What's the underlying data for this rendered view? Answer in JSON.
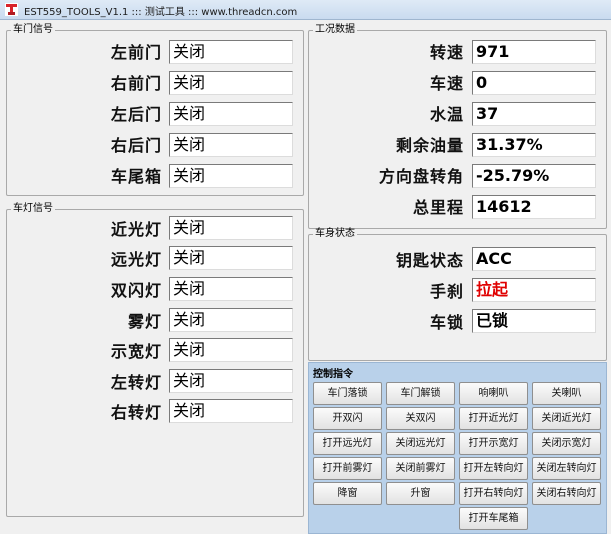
{
  "window": {
    "title": "EST559_TOOLS_V1.1 ::: 测试工具 ::: www.threadcn.com"
  },
  "door_group": {
    "title": "车门信号",
    "rows": [
      {
        "label": "左前门",
        "value": "关闭"
      },
      {
        "label": "右前门",
        "value": "关闭"
      },
      {
        "label": "左后门",
        "value": "关闭"
      },
      {
        "label": "右后门",
        "value": "关闭"
      },
      {
        "label": "车尾箱",
        "value": "关闭"
      }
    ]
  },
  "light_group": {
    "title": "车灯信号",
    "rows": [
      {
        "label": "近光灯",
        "value": "关闭"
      },
      {
        "label": "远光灯",
        "value": "关闭"
      },
      {
        "label": "双闪灯",
        "value": "关闭"
      },
      {
        "label": "雾灯",
        "value": "关闭"
      },
      {
        "label": "示宽灯",
        "value": "关闭"
      },
      {
        "label": "左转灯",
        "value": "关闭"
      },
      {
        "label": "右转灯",
        "value": "关闭"
      }
    ]
  },
  "work_group": {
    "title": "工况数据",
    "rows": [
      {
        "label": "转速",
        "value": "971"
      },
      {
        "label": "车速",
        "value": "0"
      },
      {
        "label": "水温",
        "value": "37"
      },
      {
        "label": "剩余油量",
        "value": "31.37%"
      },
      {
        "label": "方向盘转角",
        "value": "-25.79%"
      },
      {
        "label": "总里程",
        "value": "14612"
      }
    ]
  },
  "body_group": {
    "title": "车身状态",
    "rows": [
      {
        "label": "钥匙状态",
        "value": "ACC"
      },
      {
        "label": "手刹",
        "value": "拉起"
      },
      {
        "label": "车锁",
        "value": "已锁"
      }
    ]
  },
  "control": {
    "title": "控制指令",
    "buttons": [
      "车门落锁",
      "车门解锁",
      "响喇叭",
      "关喇叭",
      "开双闪",
      "关双闪",
      "打开近光灯",
      "关闭近光灯",
      "打开远光灯",
      "关闭远光灯",
      "打开示宽灯",
      "关闭示宽灯",
      "打开前雾灯",
      "关闭前雾灯",
      "打开左转向灯",
      "关闭左转向灯",
      "降窗",
      "升窗",
      "打开右转向灯",
      "关闭右转向灯",
      "打开车尾箱"
    ]
  },
  "colors": {
    "handbrake_value": "#e00000",
    "control_panel_bg": "#b9d1ea"
  }
}
